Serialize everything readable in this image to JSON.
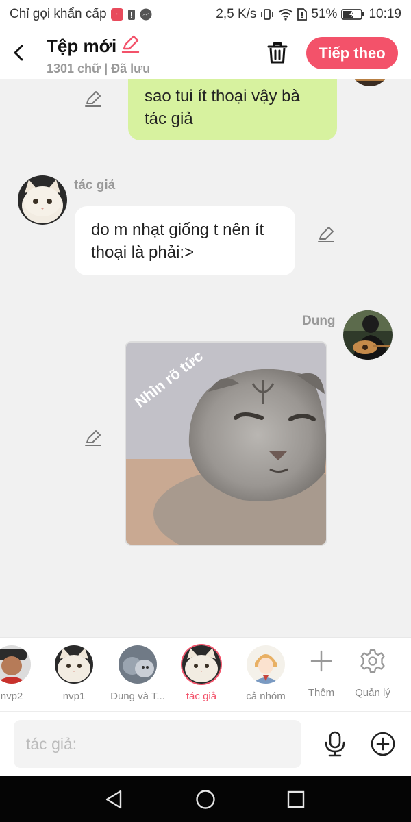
{
  "status_bar": {
    "carrier_text": "Chỉ gọi khẩn cấp",
    "speed": "2,5 K/s",
    "battery": "51%",
    "time": "10:19"
  },
  "header": {
    "title": "Tệp mới",
    "word_count": "1301 chữ",
    "separator": "|",
    "save_status": "Đã lưu",
    "next_label": "Tiếp theo"
  },
  "messages": [
    {
      "side": "right",
      "type": "text",
      "text": "sao tui ít thoại vậy bà tác giả"
    },
    {
      "side": "left",
      "type": "text",
      "sender": "tác giả",
      "text": "do m nhạt giống t nên ít thoại là phải:>"
    },
    {
      "side": "right",
      "type": "image",
      "sender": "Dung",
      "image_caption": "Nhìn rõ tức"
    }
  ],
  "characters": [
    {
      "label": "nvp2"
    },
    {
      "label": "nvp1"
    },
    {
      "label": "Dung và T..."
    },
    {
      "label": "tác giả",
      "active": true
    },
    {
      "label": "cả nhóm"
    }
  ],
  "tools": {
    "add_label": "Thêm",
    "manage_label": "Quản lý"
  },
  "input": {
    "placeholder": "tác giả:"
  },
  "colors": {
    "accent": "#f3526a",
    "bubble_green": "#d7f29f",
    "chat_bg": "#f1f1f1"
  }
}
